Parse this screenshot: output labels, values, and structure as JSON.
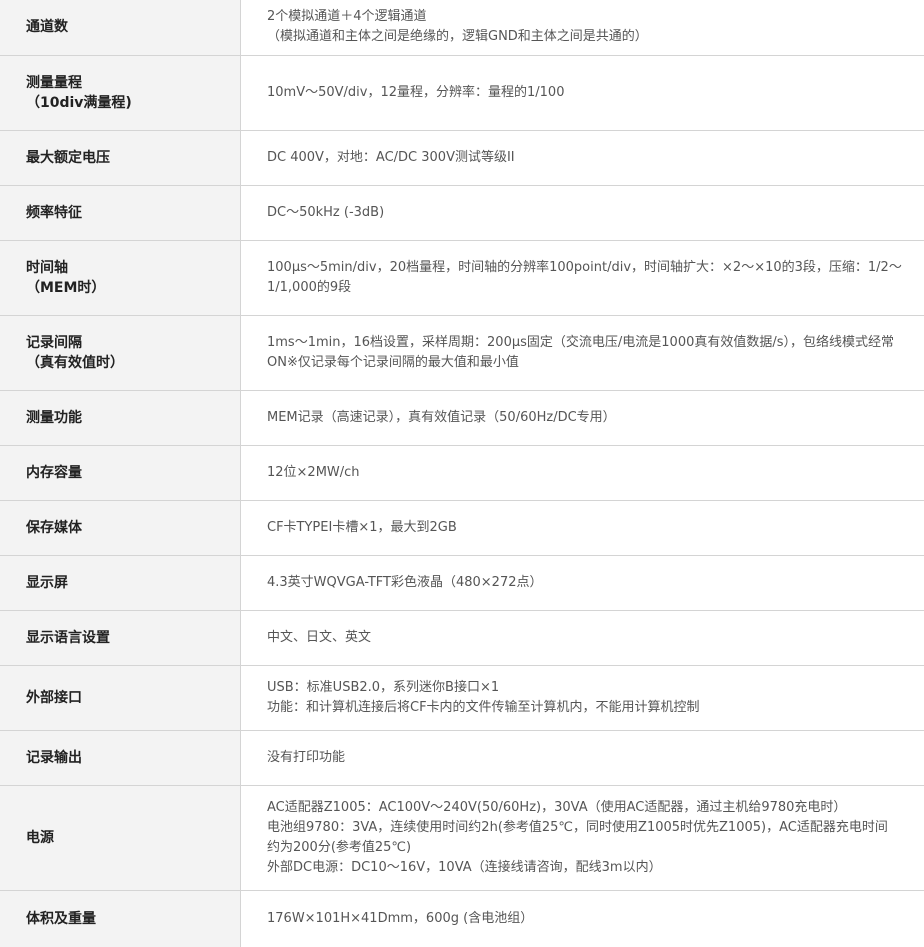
{
  "rows": [
    {
      "label": [
        "通道数"
      ],
      "value": [
        "2个模拟通道＋4个逻辑通道",
        "（模拟通道和主体之间是绝缘的，逻辑GND和主体之间是共通的）"
      ]
    },
    {
      "label": [
        "测量量程",
        "（10div满量程)"
      ],
      "value": [
        "10mV～50V/div，12量程，分辨率：量程的1/100"
      ]
    },
    {
      "label": [
        "最大额定电压"
      ],
      "value": [
        "DC 400V，对地：AC/DC 300V测试等级II"
      ]
    },
    {
      "label": [
        "频率特征"
      ],
      "value": [
        "DC～50kHz (-3dB)"
      ]
    },
    {
      "label": [
        "时间轴",
        "（MEM时）"
      ],
      "value": [
        "100μs～5min/div，20档量程，时间轴的分辨率100point/div，时间轴扩大：×2～×10的3段，压缩：1/2～",
        "1/1,000的9段"
      ]
    },
    {
      "label": [
        "记录间隔",
        "（真有效值时）"
      ],
      "value": [
        "1ms～1min，16档设置，采样周期：200μs固定（交流电压/电流是1000真有效值数据/s），包络线模式经常",
        "ON※仅记录每个记录间隔的最大值和最小值"
      ]
    },
    {
      "label": [
        "测量功能"
      ],
      "value": [
        "MEM记录（高速记录），真有效值记录（50/60Hz/DC专用）"
      ]
    },
    {
      "label": [
        "内存容量"
      ],
      "value": [
        "12位×2MW/ch"
      ]
    },
    {
      "label": [
        "保存媒体"
      ],
      "value": [
        "CF卡TYPEⅠ卡槽×1，最大到2GB"
      ]
    },
    {
      "label": [
        "显示屏"
      ],
      "value": [
        "4.3英寸WQVGA-TFT彩色液晶（480×272点）"
      ]
    },
    {
      "label": [
        "显示语言设置"
      ],
      "value": [
        "中文、日文、英文"
      ]
    },
    {
      "label": [
        "外部接口"
      ],
      "value": [
        "USB：标准USB2.0，系列迷你B接口×1",
        "功能：和计算机连接后将CF卡内的文件传输至计算机内，不能用计算机控制"
      ]
    },
    {
      "label": [
        "记录输出"
      ],
      "value": [
        "没有打印功能"
      ]
    },
    {
      "label": [
        "电源"
      ],
      "value": [
        "AC适配器Z1005：AC100V～240V(50/60Hz)，30VA（使用AC适配器，通过主机给9780充电时）",
        "电池组9780：3VA，连续使用时间约2h(参考值25℃，同时使用Z1005时优先Z1005)，AC适配器充电时间",
        "约为200分(参考值25℃)",
        "外部DC电源：DC10～16V，10VA（连接线请咨询，配线3m以内）"
      ]
    },
    {
      "label": [
        "体积及重量"
      ],
      "value": [
        "176W×101H×41Dmm，600g (含电池组）"
      ]
    }
  ]
}
